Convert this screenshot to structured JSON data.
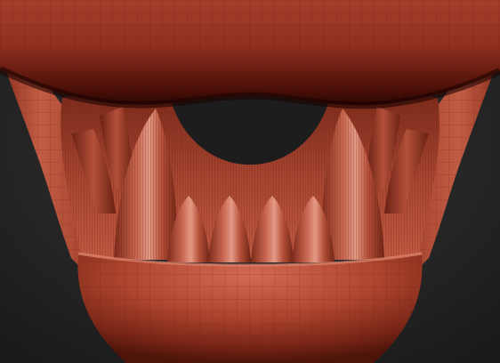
{
  "viewport": {
    "background_color": "#1c1c1c",
    "background_highlight": "#333333",
    "mesh_base_color": "#b84a34",
    "mesh_shadow_color": "#3a0b05",
    "mesh_highlight_color": "#e08670",
    "wireframe_visible": true,
    "subject": "sculpted-creature-jaw-with-fangs"
  }
}
